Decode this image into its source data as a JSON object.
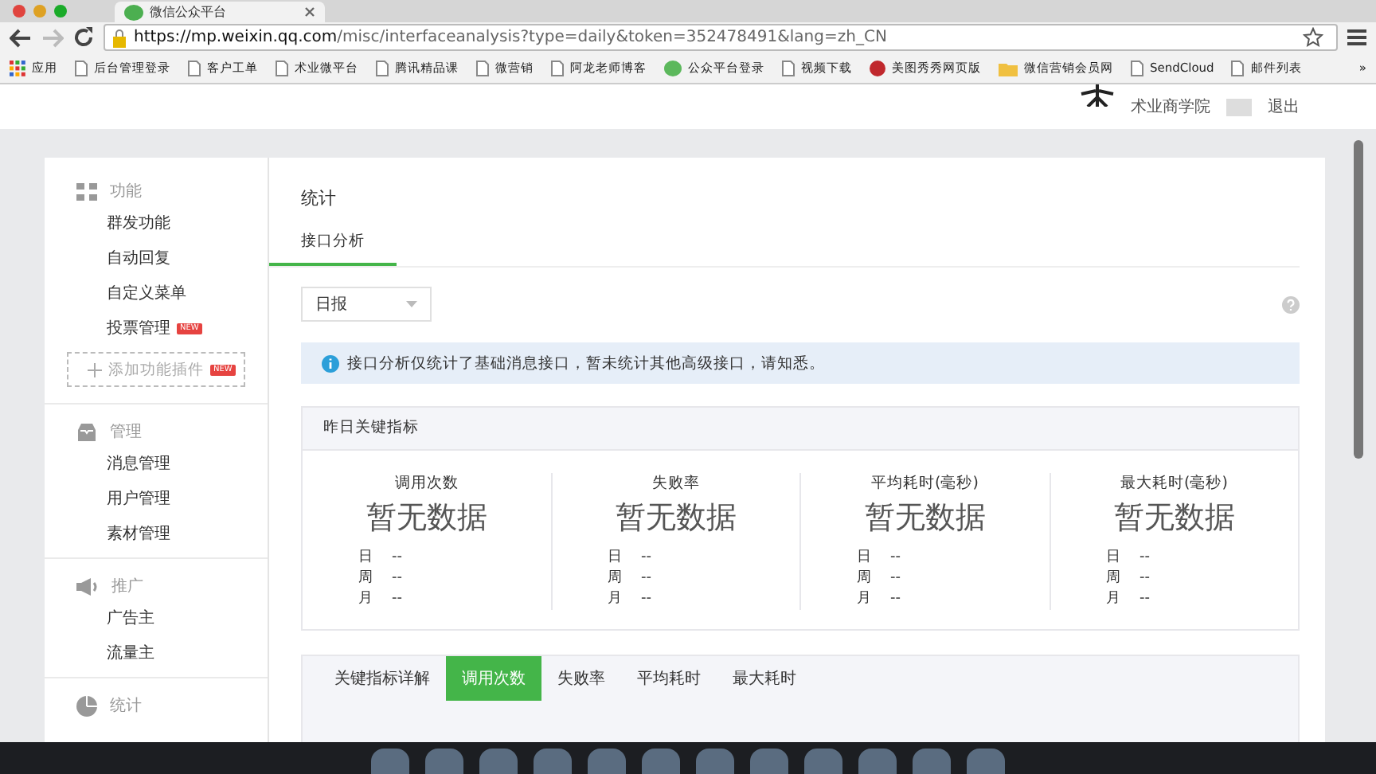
{
  "browser": {
    "tab_title": "微信公众平台",
    "url_host": "https://mp.weixin.qq.com",
    "url_path": "/misc/interfaceanalysis?type=daily&token=352478491&lang=zh_CN",
    "bookmarks": [
      {
        "label": "应用",
        "kind": "apps"
      },
      {
        "label": "后台管理登录",
        "kind": "page"
      },
      {
        "label": "客户工单",
        "kind": "page"
      },
      {
        "label": "术业微平台",
        "kind": "page"
      },
      {
        "label": "腾讯精品课",
        "kind": "page"
      },
      {
        "label": "微营销",
        "kind": "page"
      },
      {
        "label": "阿龙老师博客",
        "kind": "page"
      },
      {
        "label": "公众平台登录",
        "kind": "wechat"
      },
      {
        "label": "视频下载",
        "kind": "page"
      },
      {
        "label": "美图秀秀网页版",
        "kind": "meitu"
      },
      {
        "label": "微信营销会员网",
        "kind": "folder"
      },
      {
        "label": "SendCloud",
        "kind": "page"
      },
      {
        "label": "邮件列表",
        "kind": "page"
      }
    ],
    "more": "»"
  },
  "header": {
    "account": "术业商学院",
    "logout": "退出"
  },
  "sidebar": [
    {
      "title": "功能",
      "kind": "grid",
      "items": [
        {
          "label": "群发功能"
        },
        {
          "label": "自动回复"
        },
        {
          "label": "自定义菜单"
        },
        {
          "label": "投票管理",
          "badge": "NEW"
        }
      ],
      "add_button": {
        "label": "添加功能插件",
        "badge": "NEW"
      }
    },
    {
      "title": "管理",
      "kind": "inbox",
      "items": [
        {
          "label": "消息管理"
        },
        {
          "label": "用户管理"
        },
        {
          "label": "素材管理"
        }
      ]
    },
    {
      "title": "推广",
      "kind": "megaphone",
      "items": [
        {
          "label": "广告主"
        },
        {
          "label": "流量主"
        }
      ]
    },
    {
      "title": "统计",
      "kind": "pie"
    }
  ],
  "main": {
    "title": "统计",
    "tabs": [
      {
        "label": "接口分析",
        "selected": true
      }
    ],
    "period_select": {
      "value": "日报"
    },
    "notice": "接口分析仅统计了基础消息接口，暂未统计其他高级接口，请知悉。",
    "summary": {
      "title": "昨日关键指标",
      "metrics": [
        {
          "label": "调用次数",
          "value": "暂无数据",
          "rows": [
            {
              "label": "日",
              "value": "--"
            },
            {
              "label": "周",
              "value": "--"
            },
            {
              "label": "月",
              "value": "--"
            }
          ]
        },
        {
          "label": "失败率",
          "value": "暂无数据",
          "rows": [
            {
              "label": "日",
              "value": "--"
            },
            {
              "label": "周",
              "value": "--"
            },
            {
              "label": "月",
              "value": "--"
            }
          ]
        },
        {
          "label": "平均耗时(毫秒)",
          "value": "暂无数据",
          "rows": [
            {
              "label": "日",
              "value": "--"
            },
            {
              "label": "周",
              "value": "--"
            },
            {
              "label": "月",
              "value": "--"
            }
          ]
        },
        {
          "label": "最大耗时(毫秒)",
          "value": "暂无数据",
          "rows": [
            {
              "label": "日",
              "value": "--"
            },
            {
              "label": "周",
              "value": "--"
            },
            {
              "label": "月",
              "value": "--"
            }
          ]
        }
      ]
    },
    "detail": {
      "title": "关键指标详解",
      "tabs": [
        {
          "label": "调用次数",
          "selected": true
        },
        {
          "label": "失败率",
          "selected": false
        },
        {
          "label": "平均耗时",
          "selected": false
        },
        {
          "label": "最大耗时",
          "selected": false
        }
      ]
    }
  }
}
